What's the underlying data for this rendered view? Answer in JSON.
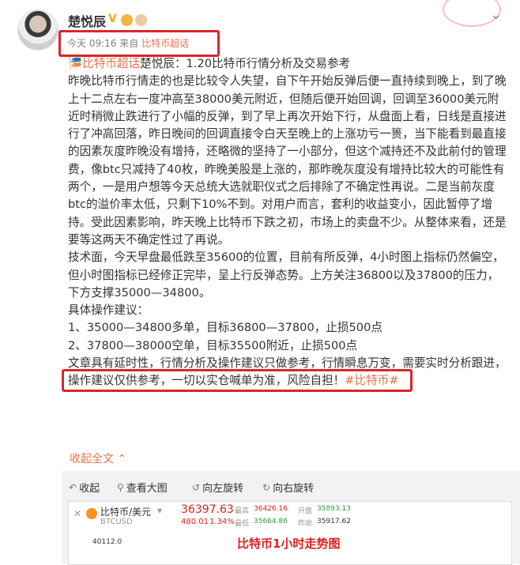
{
  "header": {
    "author": "楚悦辰",
    "verified_badge": "V",
    "time": "今天 09:16",
    "from_prefix": "来自",
    "source": "比特币超话"
  },
  "post": {
    "topic": "比特币超话",
    "title": "楚悦辰：1.20比特币行情分析及交易参考",
    "para1": "昨晚比特币行情走的也是比较令人失望，自下午开始反弹后便一直持续到晚上，到了晚上十二点左右一度冲高至38000美元附近，但随后便开始回调，回调至36000美元附近时稍微止跌进行了小幅的反弹，到了早上再次开始下行，从盘面上看，日线是直接进行了冲高回落，昨日晚间的回调直接令白天至晚上的上涨功亏一篑，当下能看到最直接的因素灰度昨晚没有增持，还略微的坚持了一小部分，但这个减持还不及此前付的管理费，像btc只减持了40枚，昨晚美股是上涨的，那昨晚灰度没有增持比较大的可能性有两个，一是用户想等今天总统大选就职仪式之后排除了不确定性再说。二是当前灰度btc的溢价率太低，只剩下10%不到。对用户而言，套利的收益变小，因此暂停了增持。受此因素影响，昨天晚上比特币下跌之初，市场上的卖盘不少。从整体来看，还是要等这两天不确定性过了再说。",
    "para2": "技术面，今天早盘最低跌至35600的位置，目前有所反弹，4小时图上指标仍然偏空，但小时图指标已经修正完毕，呈上行反弹态势。上方关注36800以及37800的压力，下方支撑35000—34800。",
    "advice_title": "具体操作建议：",
    "advice1": "1、35000—34800多单，目标36800—37800，止损500点",
    "advice2": "2、37800—38000空单，目标35500附近，止损500点",
    "disclaimer": "文章具有延时性，行情分析及操作建议只做参考，行情瞬息万变，需要实时分析跟进，操作建议仅供参考，一切以实仓喊单为准，风险自担！",
    "hashtag": "#比特币#",
    "fold_label": "收起全文"
  },
  "toolbar": {
    "collapse": "收起",
    "view_large": "查看大图",
    "rotate_left": "向左旋转",
    "rotate_right": "向右旋转"
  },
  "image_preview": {
    "pair": "比特币/美元",
    "code": "BTCUSD",
    "price": "36397.63",
    "change": "480.01",
    "change_pct": "1.34%",
    "high_label": "最高",
    "high": "36426.16",
    "low_label": "最低",
    "low": "35664.86",
    "vol_label": "开盘",
    "open": "35893.13",
    "close_label": "昨收",
    "prev": "35917.62",
    "axis_value": "40112.0",
    "caption": "比特币1小时走势图"
  }
}
